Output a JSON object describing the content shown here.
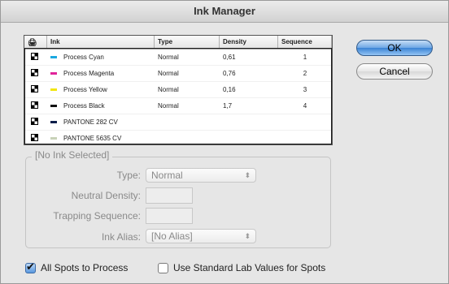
{
  "dialog": {
    "title": "Ink Manager",
    "ok_label": "OK",
    "cancel_label": "Cancel"
  },
  "ink_table": {
    "headers": {
      "icon": "",
      "ink": "Ink",
      "type": "Type",
      "density": "Density",
      "sequence": "Sequence"
    },
    "rows": [
      {
        "ink": "Process Cyan",
        "type": "Normal",
        "density": "0,61",
        "sequence": "1",
        "swatch": "#1aa8e0"
      },
      {
        "ink": "Process Magenta",
        "type": "Normal",
        "density": "0,76",
        "sequence": "2",
        "swatch": "#e0249a"
      },
      {
        "ink": "Process Yellow",
        "type": "Normal",
        "density": "0,16",
        "sequence": "3",
        "swatch": "#f2e610"
      },
      {
        "ink": "Process Black",
        "type": "Normal",
        "density": "1,7",
        "sequence": "4",
        "swatch": "#111111"
      },
      {
        "ink": "PANTONE 282 CV",
        "type": "",
        "density": "",
        "sequence": "",
        "swatch": "#0b1e4a"
      },
      {
        "ink": "PANTONE 5635 CV",
        "type": "",
        "density": "",
        "sequence": "",
        "swatch": "#c8d2b8"
      }
    ]
  },
  "selection": {
    "group_title": "[No Ink Selected]",
    "type_label": "Type:",
    "type_value": "Normal",
    "neutral_density_label": "Neutral Density:",
    "trapping_sequence_label": "Trapping Sequence:",
    "ink_alias_label": "Ink Alias:",
    "ink_alias_value": "[No Alias]"
  },
  "options": {
    "all_spots_label": "All Spots to Process",
    "all_spots_checked": true,
    "lab_values_label": "Use Standard Lab Values for Spots",
    "lab_values_checked": false
  }
}
